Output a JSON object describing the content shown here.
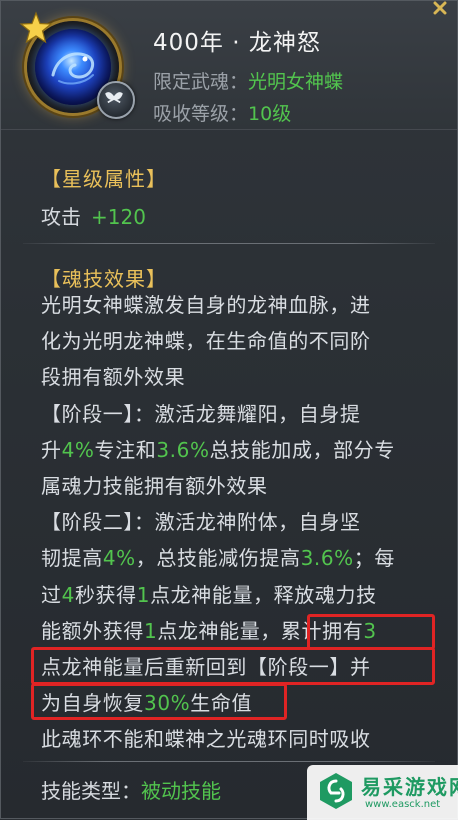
{
  "header": {
    "title": "400年 · 龙神怒",
    "spirit_label": "限定武魂：",
    "spirit_value": "光明女神蝶",
    "level_label": "吸收等级：",
    "level_value": "10级"
  },
  "star_section": {
    "title": "【星级属性】",
    "stat_label": "攻击",
    "stat_value": "+120"
  },
  "skill_section": {
    "title": "【魂技效果】",
    "lines": [
      [
        {
          "t": "光明女神蝶激发自身的龙神血脉，进"
        }
      ],
      [
        {
          "t": "化为光明龙神蝶，在生命值的不同阶"
        }
      ],
      [
        {
          "t": "段拥有额外效果"
        }
      ],
      [
        {
          "t": "【阶段一】：激活龙舞耀阳，自身提"
        }
      ],
      [
        {
          "t": "升"
        },
        {
          "t": "4%",
          "g": true
        },
        {
          "t": "专注和"
        },
        {
          "t": "3.6%",
          "g": true
        },
        {
          "t": "总技能加成，部分专"
        }
      ],
      [
        {
          "t": "属魂力技能拥有额外效果"
        }
      ],
      [
        {
          "t": "【阶段二】：激活龙神附体，自身坚"
        }
      ],
      [
        {
          "t": "韧提高"
        },
        {
          "t": "4%",
          "g": true
        },
        {
          "t": "，总技能减伤提高"
        },
        {
          "t": "3.6%",
          "g": true
        },
        {
          "t": "；每"
        }
      ],
      [
        {
          "t": "过"
        },
        {
          "t": "4",
          "g": true
        },
        {
          "t": "秒获得"
        },
        {
          "t": "1",
          "g": true
        },
        {
          "t": "点龙神能量，释放魂力技"
        }
      ],
      [
        {
          "t": "能额外获得"
        },
        {
          "t": "1",
          "g": true
        },
        {
          "t": "点龙神能量，累计拥有"
        },
        {
          "t": "3",
          "g": true
        }
      ],
      [
        {
          "t": "点龙神能量后重新回到【阶段一】并"
        }
      ],
      [
        {
          "t": "为自身恢复"
        },
        {
          "t": "30%",
          "g": true
        },
        {
          "t": "生命值"
        }
      ],
      [
        {
          "t": "此魂环不能和蝶神之光魂环同时吸收"
        }
      ]
    ]
  },
  "skill_type": {
    "label": "技能类型：",
    "value": "被动技能"
  },
  "watermark": {
    "title": "易采游戏网",
    "url": "www.easck.net"
  },
  "colors": {
    "accent_gold": "#e9c05a",
    "value_green": "#52c44e",
    "highlight_red": "#e02424"
  }
}
